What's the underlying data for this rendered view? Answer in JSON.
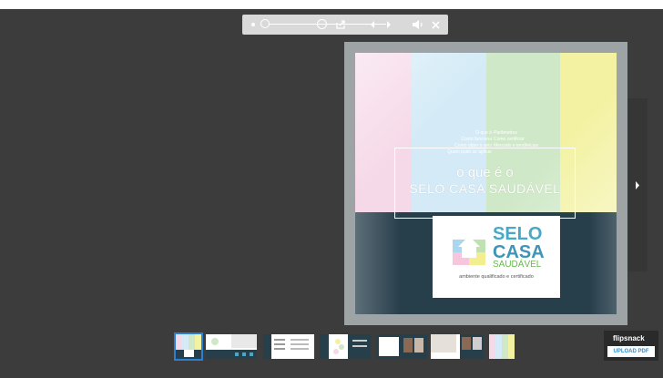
{
  "toolbar": {
    "icons": [
      "zoom-out-icon",
      "zoom-slider",
      "zoom-in-icon",
      "share-icon",
      "prev-page-icon",
      "next-page-icon",
      "volume-icon",
      "close-icon"
    ]
  },
  "cover": {
    "colors": {
      "stripe_pink": "#f6d9e8",
      "stripe_blue": "#d4ebf7",
      "stripe_green": "#cfe8c7",
      "stripe_yellow": "#f3f2a3",
      "dark_band": "#273e4b",
      "book_frame": "#9ea3a6"
    },
    "toc_left": [
      "O que é",
      "Como funciona",
      "Como obter o selo",
      "Quem pode se aplicar"
    ],
    "toc_right": [
      "Parâmetros",
      "Como certificar",
      "Mercado e tendências"
    ],
    "title_line1": "o que é o",
    "title_line2": "SELO CASA SAUDÁVEL",
    "logo": {
      "word1": "SELO",
      "word2": "CASA",
      "word3": "SAUDÁVEL",
      "tagline": "ambiente qualificado e certificado"
    }
  },
  "thumbnails": [
    {
      "name": "thumb-cover",
      "active": true
    },
    {
      "name": "thumb-page-2-3",
      "active": false
    },
    {
      "name": "thumb-page-4-5",
      "active": false
    },
    {
      "name": "thumb-page-6-7",
      "active": false
    },
    {
      "name": "thumb-page-8-9",
      "active": false
    },
    {
      "name": "thumb-page-10-11",
      "active": false
    },
    {
      "name": "thumb-back",
      "active": false
    }
  ],
  "brand": {
    "name": "flipsnack",
    "upload_label": "UPLOAD PDF"
  },
  "accent_color": "#2c7fd2"
}
